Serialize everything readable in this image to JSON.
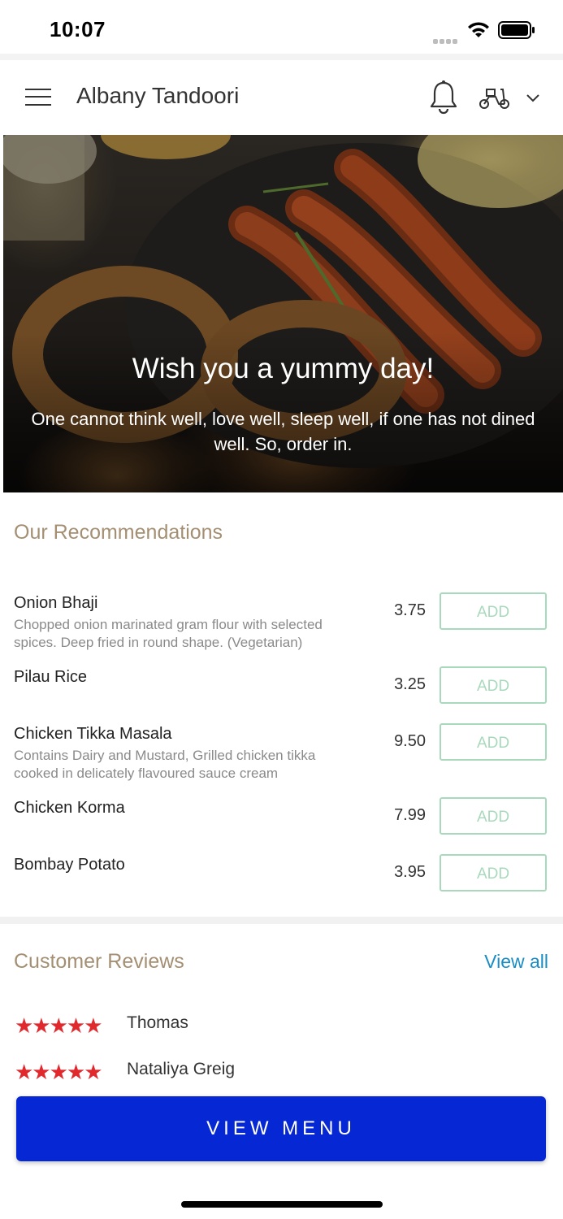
{
  "status_bar": {
    "time": "10:07"
  },
  "header": {
    "title": "Albany Tandoori",
    "menu_icon": "hamburger-menu-icon",
    "notification_icon": "bell-icon",
    "delivery_icon": "scooter-icon",
    "dropdown_icon": "chevron-down-icon"
  },
  "hero": {
    "title": "Wish you a yummy day!",
    "text": "One cannot think well, love well, sleep well, if one has not dined well. So, order in."
  },
  "recommendations": {
    "title": "Our Recommendations",
    "items": [
      {
        "name": "Onion Bhaji",
        "description": "Chopped onion marinated gram flour with selected spices. Deep fried in round shape. (Vegetarian)",
        "price": "3.75",
        "add_label": "ADD"
      },
      {
        "name": "Pilau Rice",
        "description": "",
        "price": "3.25",
        "add_label": "ADD"
      },
      {
        "name": "Chicken Tikka Masala",
        "description": "Contains Dairy and Mustard, Grilled chicken tikka cooked in delicately flavoured sauce cream",
        "price": "9.50",
        "add_label": "ADD"
      },
      {
        "name": "Chicken Korma",
        "description": "",
        "price": "7.99",
        "add_label": "ADD"
      },
      {
        "name": "Bombay Potato",
        "description": "",
        "price": "3.95",
        "add_label": "ADD"
      }
    ]
  },
  "reviews": {
    "title": "Customer Reviews",
    "view_all": "View all",
    "items": [
      {
        "name": "Thomas",
        "rating": 5,
        "stars": "★★★★★"
      },
      {
        "name": "Nataliya Greig",
        "rating": 5,
        "stars": "★★★★★"
      }
    ]
  },
  "cta": {
    "label": "VIEW MENU"
  },
  "colors": {
    "accent_section_title": "#a48f73",
    "add_button": "#a9d9bd",
    "link": "#1a8dc4",
    "primary_button": "#0628d4",
    "star": "#e0282d"
  }
}
